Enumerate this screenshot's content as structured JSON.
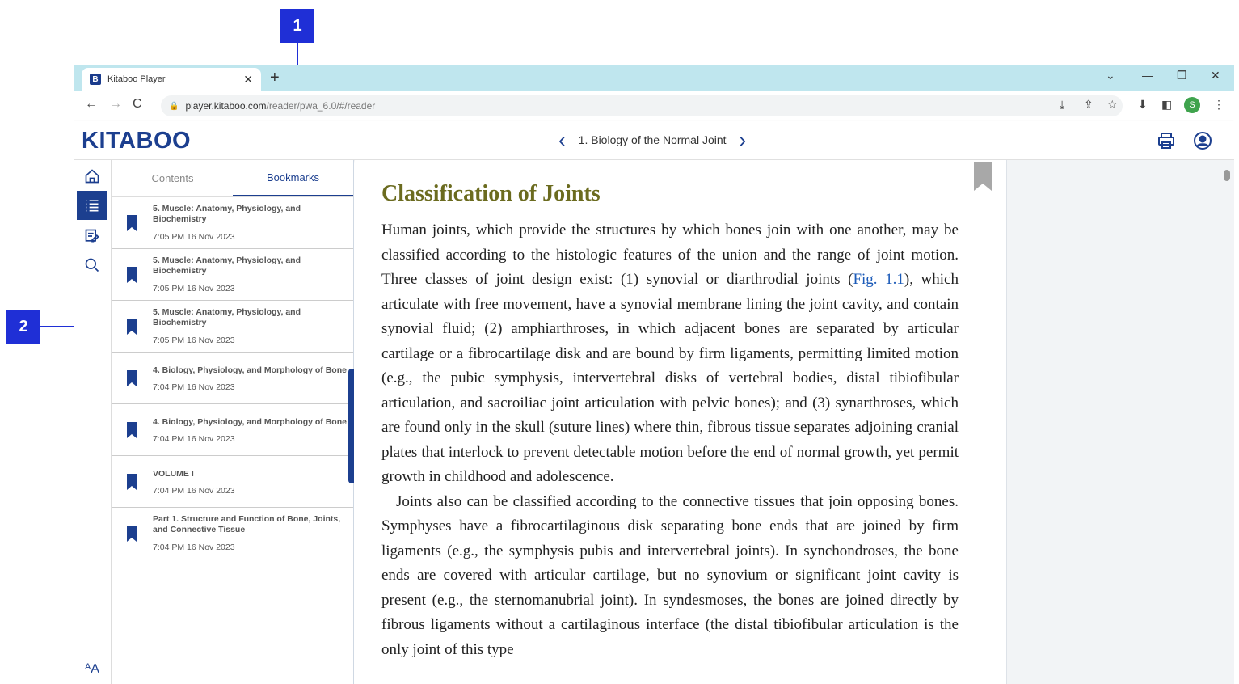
{
  "callouts": {
    "c1": "1",
    "c2": "2"
  },
  "browser": {
    "tab_title": "Kitaboo Player",
    "favicon": "B",
    "url_host": "player.kitaboo.com",
    "url_path": "/reader/pwa_6.0/#/reader",
    "profile_initial": "S"
  },
  "app": {
    "logo": "KITABOO",
    "chapter_title": "1. Biology of the Normal Joint"
  },
  "panel": {
    "tabs": [
      "Contents",
      "Bookmarks"
    ],
    "active_tab": "Bookmarks",
    "bookmarks": [
      {
        "title": "5. Muscle: Anatomy, Physiology, and Biochemistry",
        "time": "7:05 PM 16 Nov 2023"
      },
      {
        "title": "5. Muscle: Anatomy, Physiology, and Biochemistry",
        "time": "7:05 PM 16 Nov 2023"
      },
      {
        "title": "5. Muscle: Anatomy, Physiology, and Biochemistry",
        "time": "7:05 PM 16 Nov 2023"
      },
      {
        "title": "4. Biology, Physiology, and Morphology of Bone",
        "time": "7:04 PM 16 Nov 2023"
      },
      {
        "title": "4. Biology, Physiology, and Morphology of Bone",
        "time": "7:04 PM 16 Nov 2023"
      },
      {
        "title": "VOLUME I",
        "time": "7:04 PM 16 Nov 2023"
      },
      {
        "title": "Part 1. Structure and Function of Bone, Joints, and Connective Tissue",
        "time": "7:04 PM 16 Nov 2023"
      }
    ]
  },
  "reader": {
    "heading": "Classification of Joints",
    "p1_a": "Human joints, which provide the structures by which bones join with one another, may be classified according to the histologic features of the union and the range of joint motion. Three classes of joint design exist: (1) synovial or diarthrodial joints (",
    "p1_fig": "Fig. 1.1",
    "p1_b": "), which articulate with free movement, have a synovial membrane lining the joint cavity, and contain synovial fluid; (2) amphiarthroses, in which adjacent bones are separated by articular cartilage or a fibrocartilage disk and are bound by firm ligaments, permitting limited motion (e.g., the pubic symphysis, intervertebral disks of vertebral bodies, distal tibiofibular articulation, and sacroiliac joint articulation with pelvic bones); and (3) synarthroses, which are found only in the skull (suture lines) where thin, fibrous tissue separates adjoining cranial plates that interlock to prevent detectable motion before the end of normal growth, yet permit growth in childhood and adolescence.",
    "p2": "Joints also can be classified according to the connective tissues that join opposing bones. Symphyses have a fibrocartilaginous disk separating bone ends that are joined by firm ligaments (e.g., the symphysis pubis and intervertebral joints). In synchondroses, the bone ends are covered with articular cartilage, but no synovium or significant joint cavity is present (e.g., the sternomanubrial joint). In syndesmoses, the bones are joined directly by fibrous ligaments without a cartilaginous interface (the distal tibiofibular articulation is the only joint of this type"
  },
  "colors": {
    "brand": "#1c3f8f",
    "callout": "#1f2fd6",
    "heading": "#6b6b1f"
  },
  "icons": [
    "home-icon",
    "toc-list-icon",
    "notes-icon",
    "search-icon",
    "font-size-icon",
    "print-icon",
    "user-icon",
    "bookmark-icon"
  ]
}
